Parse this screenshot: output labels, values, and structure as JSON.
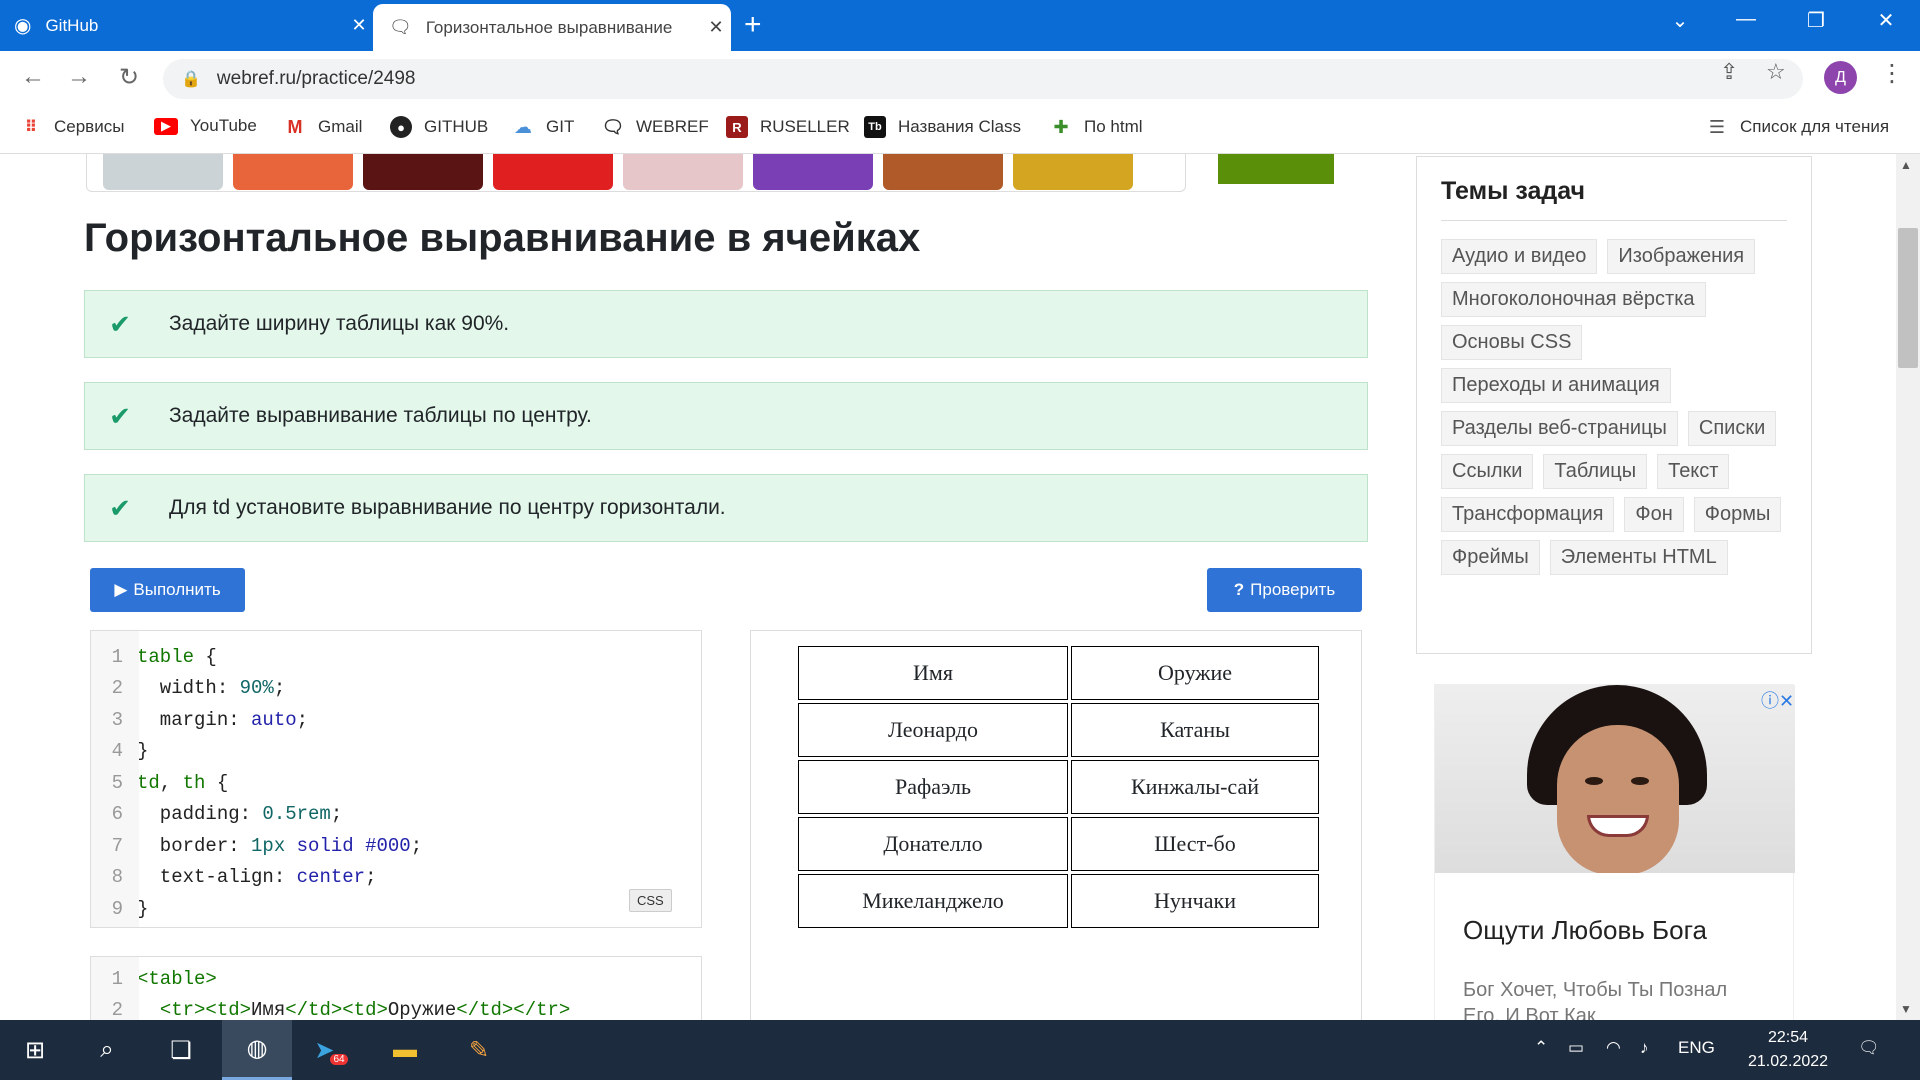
{
  "browser": {
    "tabs": [
      {
        "title": "GitHub",
        "icon": "github-icon"
      },
      {
        "title": "Горизонтальное выравнивание",
        "icon": "chat-icon"
      }
    ],
    "url": "webref.ru/practice/2498",
    "profile_initial": "Д",
    "reading_list": "Список для чтения"
  },
  "bookmarks": [
    {
      "label": "Сервисы",
      "icon": "apps-grid-icon",
      "color": "#ea4335"
    },
    {
      "label": "YouTube",
      "icon": "youtube-icon",
      "color": "#ff0000"
    },
    {
      "label": "Gmail",
      "icon": "gmail-icon",
      "color": "#d93025"
    },
    {
      "label": "GITHUB",
      "icon": "github-icon",
      "color": "#222222"
    },
    {
      "label": "GIT",
      "icon": "cloud-icon",
      "color": "#4a90d9"
    },
    {
      "label": "WEBREF",
      "icon": "chat-icon",
      "color": "#333333"
    },
    {
      "label": "RUSELLER",
      "icon": "r-logo-icon",
      "color": "#9b1b1b"
    },
    {
      "label": "Названия Class",
      "icon": "tb-logo-icon",
      "color": "#111111"
    },
    {
      "label": "По html",
      "icon": "puzzle-icon",
      "color": "#3a8f2a"
    }
  ],
  "page": {
    "title": "Горизонтальное выравнивание в ячейках",
    "tasks": [
      "Задайте ширину таблицы как 90%.",
      "Задайте выравнивание таблицы по центру.",
      "Для td установите выравнивание по центру горизонтали."
    ],
    "run_button": "Выполнить",
    "check_button": "Проверить",
    "css_label": "CSS",
    "accent_color": "#2f73d6",
    "success_color": "#1b9a6a"
  },
  "preview_table": [
    [
      "Имя",
      "Оружие"
    ],
    [
      "Леонардо",
      "Катаны"
    ],
    [
      "Рафаэль",
      "Кинжалы-сай"
    ],
    [
      "Донателло",
      "Шест-бо"
    ],
    [
      "Микеланджело",
      "Нунчаки"
    ]
  ],
  "sidebar": {
    "topics_title": "Темы задач",
    "topics": [
      "Аудио и видео",
      "Изображения",
      "Многоколоночная вёрстка",
      "Основы CSS",
      "Переходы и анимация",
      "Разделы веб-страницы",
      "Списки",
      "Ссылки",
      "Таблицы",
      "Текст",
      "Трансформация",
      "Фон",
      "Формы",
      "Фреймы",
      "Элементы HTML"
    ],
    "ad_title": "Ощути Любовь Бога",
    "ad_text": "Бог Хочет, Чтобы Ты Познал Его. И Вот Как"
  },
  "taskbar": {
    "time": "22:54",
    "date": "21.02.2022",
    "lang": "ENG",
    "telegram_badge": "64"
  }
}
